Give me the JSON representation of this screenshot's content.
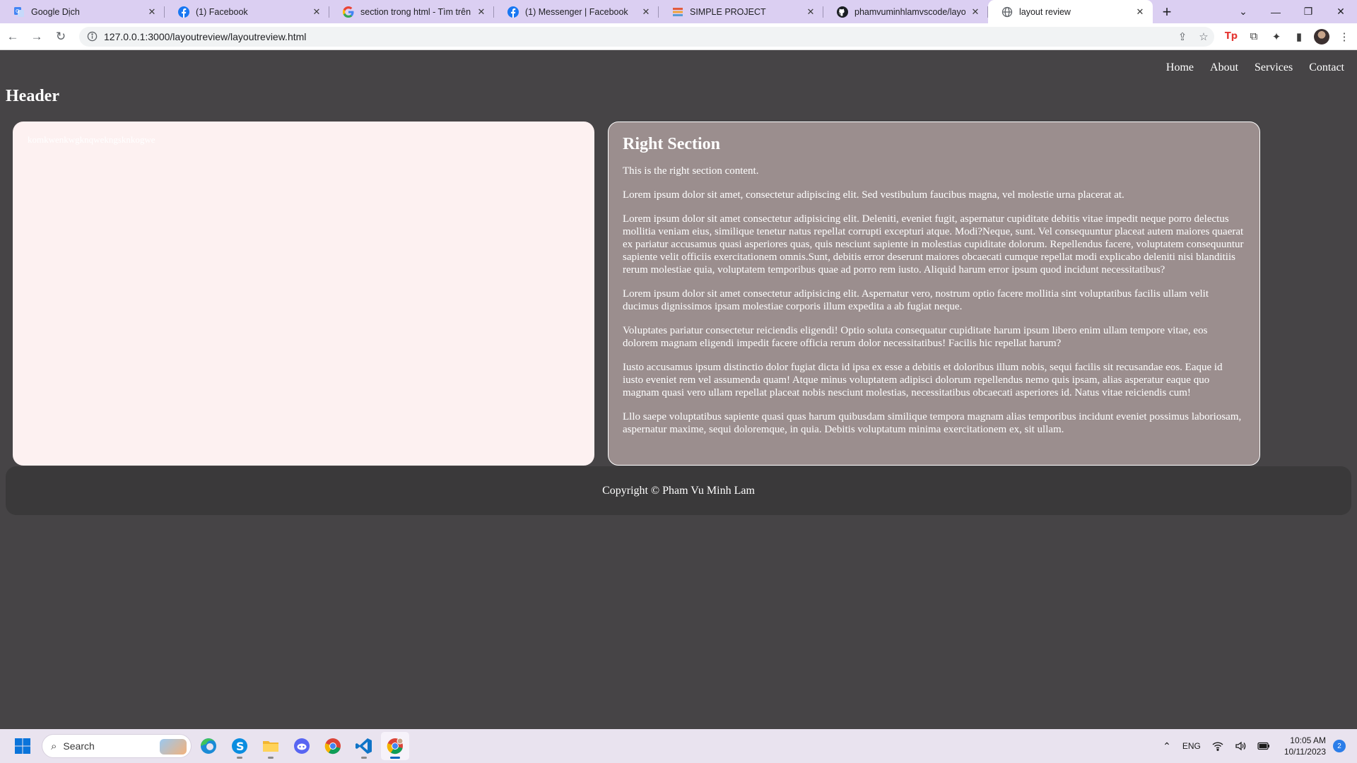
{
  "browser": {
    "tabs": [
      {
        "title": "Google Dịch",
        "icon": "google-translate-icon",
        "active": false
      },
      {
        "title": "(1) Facebook",
        "icon": "facebook-icon",
        "active": false
      },
      {
        "title": "section trong html - Tìm trên G",
        "icon": "google-icon",
        "active": false
      },
      {
        "title": "(1) Messenger | Facebook",
        "icon": "facebook-icon",
        "active": false
      },
      {
        "title": "SIMPLE PROJECT",
        "icon": "simple-project-icon",
        "active": false
      },
      {
        "title": "phamvuminhlamvscode/layout",
        "icon": "github-icon",
        "active": false
      },
      {
        "title": "layout review",
        "icon": "globe-icon",
        "active": true
      }
    ],
    "new_tab": "+",
    "url": "127.0.0.1:3000/layoutreview/layoutreview.html",
    "tab_bar_color": "#dbcff2"
  },
  "page": {
    "nav": [
      "Home",
      "About",
      "Services",
      "Contact"
    ],
    "header": "Header",
    "left_section": {
      "text": "komkwenkwgknqwekngsknkogwe",
      "background": "#fdf1f1"
    },
    "right_section": {
      "title": "Right Section",
      "paragraphs": [
        "This is the right section content.",
        "Lorem ipsum dolor sit amet, consectetur adipiscing elit. Sed vestibulum faucibus magna, vel molestie urna placerat at.",
        "Lorem ipsum dolor sit amet consectetur adipisicing elit. Deleniti, eveniet fugit, aspernatur cupiditate debitis vitae impedit neque porro delectus mollitia veniam eius, similique tenetur natus repellat corrupti excepturi atque. Modi?Neque, sunt. Vel consequuntur placeat autem maiores quaerat ex pariatur accusamus quasi asperiores quas, quis nesciunt sapiente in molestias cupiditate dolorum. Repellendus facere, voluptatem consequuntur sapiente velit officiis exercitationem omnis.Sunt, debitis error deserunt maiores obcaecati cumque repellat modi explicabo deleniti nisi blanditiis rerum molestiae quia, voluptatem temporibus quae ad porro rem iusto. Aliquid harum error ipsum quod incidunt necessitatibus?",
        "Lorem ipsum dolor sit amet consectetur adipisicing elit. Aspernatur vero, nostrum optio facere mollitia sint voluptatibus facilis ullam velit ducimus dignissimos ipsam molestiae corporis illum expedita a ab fugiat neque.",
        "Voluptates pariatur consectetur reiciendis eligendi! Optio soluta consequatur cupiditate harum ipsum libero enim ullam tempore vitae, eos dolorem magnam eligendi impedit facere officia rerum dolor necessitatibus! Facilis hic repellat harum?",
        "Iusto accusamus ipsum distinctio dolor fugiat dicta id ipsa ex esse a debitis et doloribus illum nobis, sequi facilis sit recusandae eos. Eaque id iusto eveniet rem vel assumenda quam! Atque minus voluptatem adipisci dolorum repellendus nemo quis ipsam, alias asperatur eaque quo magnam quasi vero ullam repellat placeat nobis nesciunt molestias, necessitatibus obcaecati asperiores id. Natus vitae reiciendis cum!",
        "Lllo saepe voluptatibus sapiente quasi quas harum quibusdam similique tempora magnam alias temporibus incidunt eveniet possimus laboriosam, aspernatur maxime, sequi doloremque, in quia. Debitis voluptatum minima exercitationem ex, sit ullam."
      ],
      "background": "#9b8e8e"
    },
    "footer": "Copyright © Pham Vu Minh Lam",
    "background": "#464446"
  },
  "taskbar": {
    "search_placeholder": "Search",
    "apps": [
      "edge-icon",
      "skype-icon",
      "file-explorer-icon",
      "discord-icon",
      "chrome-icon",
      "vscode-icon",
      "chrome-profile-icon"
    ],
    "language": "ENG",
    "time": "10:05 AM",
    "date": "10/11/2023",
    "notification_count": "2"
  }
}
